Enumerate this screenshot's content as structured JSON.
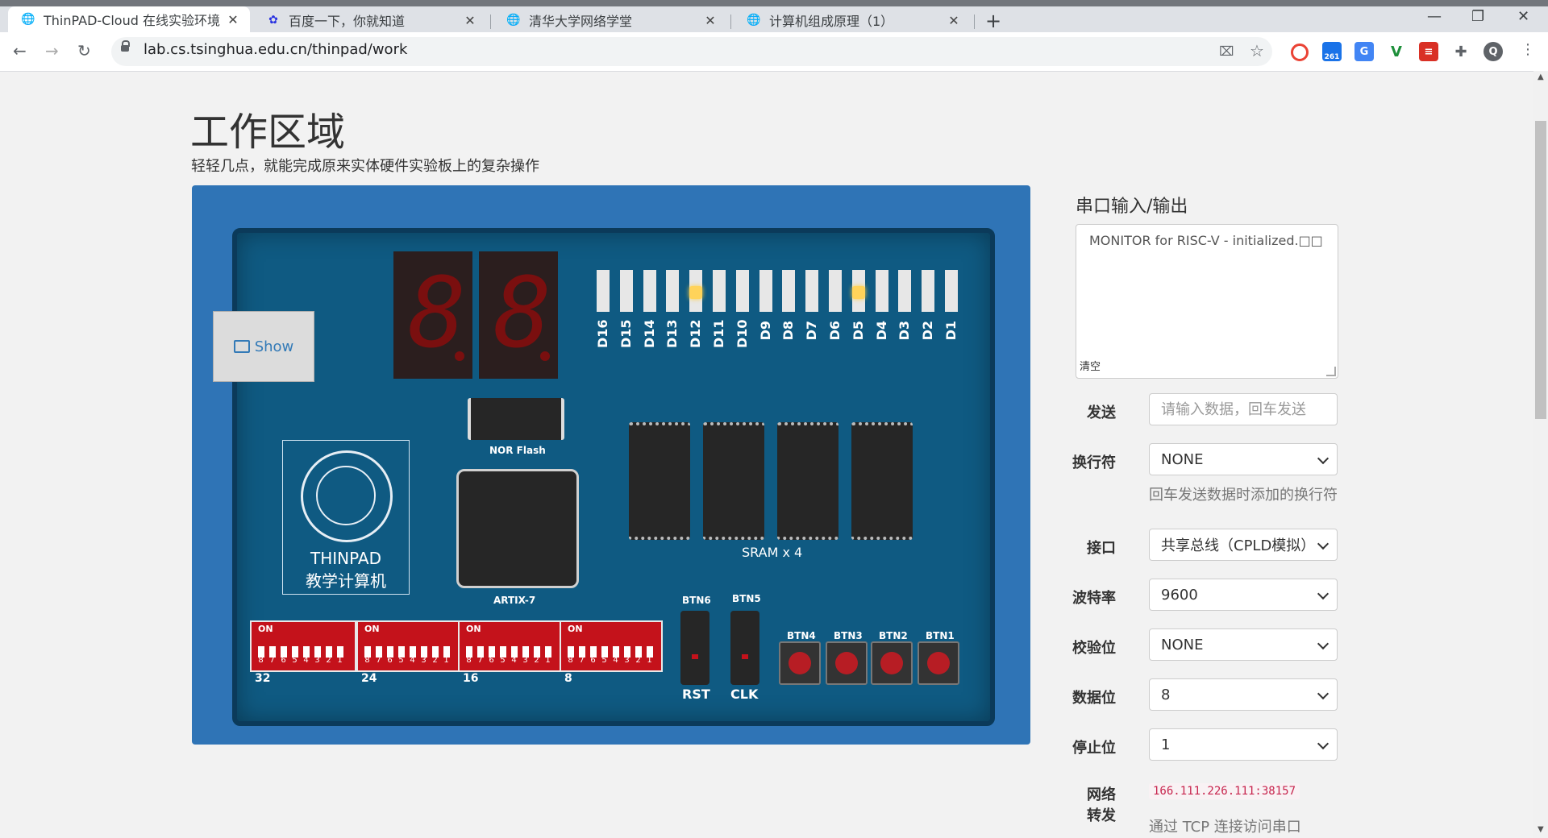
{
  "browser": {
    "tabs": [
      {
        "title": "ThinPAD-Cloud 在线实验环境",
        "active": true,
        "icon": "globe-icon"
      },
      {
        "title": "百度一下，你就知道",
        "active": false,
        "icon": "baidu-paw-icon"
      },
      {
        "title": "清华大学网络学堂",
        "active": false,
        "icon": "globe-icon"
      },
      {
        "title": "计算机组成原理（1）",
        "active": false,
        "icon": "globe-icon"
      }
    ],
    "close_glyph": "✕",
    "new_tab_glyph": "+",
    "url": "lab.cs.tsinghua.edu.cn/thinpad/work",
    "window_controls": {
      "minimize": "—",
      "restore": "❐",
      "close": "✕"
    },
    "extension_badge": "261",
    "profile_initial": "Q"
  },
  "page": {
    "title": "工作区域",
    "subtitle": "轻轻几点，就能完成原来实体硬件实验板上的复杂操作"
  },
  "board": {
    "show_button": "Show",
    "seven_seg_digits": [
      "8",
      "8"
    ],
    "leds": [
      {
        "label": "D16",
        "on": false
      },
      {
        "label": "D15",
        "on": false
      },
      {
        "label": "D14",
        "on": false
      },
      {
        "label": "D13",
        "on": false
      },
      {
        "label": "D12",
        "on": true
      },
      {
        "label": "D11",
        "on": false
      },
      {
        "label": "D10",
        "on": false
      },
      {
        "label": "D9",
        "on": false
      },
      {
        "label": "D8",
        "on": false
      },
      {
        "label": "D7",
        "on": false
      },
      {
        "label": "D6",
        "on": false
      },
      {
        "label": "D5",
        "on": true
      },
      {
        "label": "D4",
        "on": false
      },
      {
        "label": "D3",
        "on": false
      },
      {
        "label": "D2",
        "on": false
      },
      {
        "label": "D1",
        "on": false
      }
    ],
    "nor_flash_label": "NOR Flash",
    "fpga_label": "ARTIX-7",
    "sram_label": "SRAM x 4",
    "logo_line1": "THINPAD",
    "logo_line2": "教学计算机",
    "dip_on": "ON",
    "dip_numbers": [
      "8",
      "7",
      "6",
      "5",
      "4",
      "3",
      "2",
      "1"
    ],
    "dip_labels": [
      "32",
      "24",
      "16",
      "8"
    ],
    "lever_switches": [
      {
        "top": "BTN6",
        "bottom": "RST"
      },
      {
        "top": "BTN5",
        "bottom": "CLK"
      }
    ],
    "push_buttons": [
      "BTN4",
      "BTN3",
      "BTN2",
      "BTN1"
    ]
  },
  "serial": {
    "title": "串口输入/输出",
    "output": "MONITOR for RISC-V - initialized.□□",
    "clear": "清空",
    "send_label": "发送",
    "send_placeholder": "请输入数据，回车发送",
    "newline_label": "换行符",
    "newline_value": "NONE",
    "newline_help": "回车发送数据时添加的换行符",
    "interface_label": "接口",
    "interface_value": "共享总线（CPLD模拟）",
    "baud_label": "波特率",
    "baud_value": "9600",
    "parity_label": "校验位",
    "parity_value": "NONE",
    "databits_label": "数据位",
    "databits_value": "8",
    "stopbits_label": "停止位",
    "stopbits_value": "1",
    "forward_label_1": "网络",
    "forward_label_2": "转发",
    "forward_address": "166.111.226.111:38157",
    "forward_help": "通过 TCP 连接访问串口"
  },
  "colors": {
    "board_bg": "#2f74b6",
    "pcb": "#0f5a82",
    "led_on": "#ffd35a",
    "dip_red": "#c4121b"
  }
}
